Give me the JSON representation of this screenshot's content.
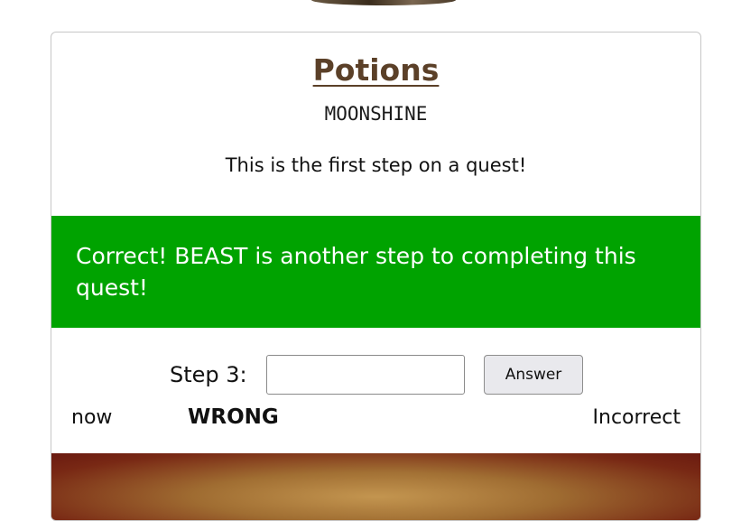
{
  "puzzle": {
    "title": "Potions",
    "subtitle": "MOONSHINE",
    "description": "This is the first step on a quest!"
  },
  "banner": {
    "message": "Correct! BEAST is another step to completing this quest!",
    "color": "#00a300"
  },
  "answer_form": {
    "step_label": "Step 3:",
    "input_value": "",
    "input_placeholder": "",
    "button_label": "Answer"
  },
  "feedback": {
    "time": "now",
    "guess": "WRONG",
    "result": "Incorrect"
  },
  "colors": {
    "title": "#5b4028",
    "banner": "#00a300",
    "button_bg": "#e9e9ed"
  }
}
